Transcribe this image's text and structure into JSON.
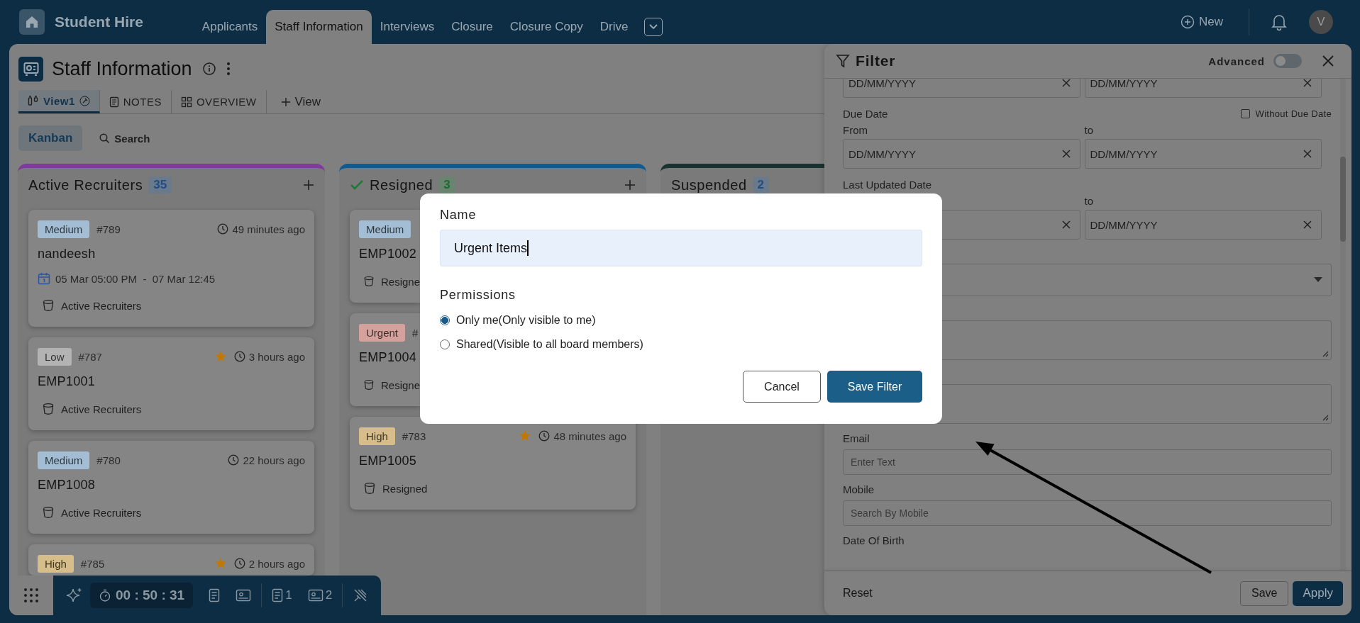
{
  "top_bar": {
    "app_name": "Student Hire",
    "tabs": [
      {
        "label": "Applicants",
        "selected": false
      },
      {
        "label": "Staff Information",
        "selected": true
      },
      {
        "label": "Interviews",
        "selected": false
      },
      {
        "label": "Closure",
        "selected": false
      },
      {
        "label": "Closure Copy",
        "selected": false
      },
      {
        "label": "Drive",
        "selected": false
      }
    ],
    "new_label": "New",
    "avatar": "V"
  },
  "page": {
    "title": "Staff Information",
    "view_tabs": [
      {
        "label": "View1",
        "selected": true,
        "kind": "view"
      },
      {
        "label": "NOTES",
        "selected": false,
        "kind": "notes"
      },
      {
        "label": "OVERVIEW",
        "selected": false,
        "kind": "overview"
      }
    ],
    "add_view": "View",
    "mode_button": "Kanban",
    "search_label": "Search"
  },
  "columns": [
    {
      "title": "Active Recruiters",
      "count": "35",
      "color": "#7f3a9a",
      "kind": "open",
      "cards": [
        {
          "priority": {
            "label": "Medium",
            "color": "#a3bdd4"
          },
          "number": "#789",
          "starred": false,
          "time": "49 minutes ago",
          "title": "nandeesh",
          "dates": "05 Mar 05:00 PM  -  07 Mar 12:45",
          "stage": "Active Recruiters"
        },
        {
          "priority": {
            "label": "Low",
            "color": "#b3b3b3"
          },
          "number": "#787",
          "starred": true,
          "time": "3 hours ago",
          "title": "EMP1001",
          "stage": "Active Recruiters"
        },
        {
          "priority": {
            "label": "Medium",
            "color": "#a3bdd4"
          },
          "number": "#780",
          "starred": false,
          "time": "22 hours ago",
          "title": "EMP1008",
          "stage": "Active Recruiters"
        },
        {
          "priority": {
            "label": "High",
            "color": "#d6bd8a"
          },
          "number": "#785",
          "starred": true,
          "time": "2 hours ago"
        }
      ]
    },
    {
      "title": "Resigned",
      "count": "3",
      "color": "#0f5a91",
      "kind": "done",
      "cards": [
        {
          "priority": {
            "label": "Medium",
            "color": "#a3bdd4"
          },
          "title": "EMP1002",
          "stage": "Resigne"
        },
        {
          "priority": {
            "label": "Urgent",
            "color": "#d4a19c"
          },
          "number": "#",
          "title": "EMP1004",
          "stage": "Resigne"
        },
        {
          "priority": {
            "label": "High",
            "color": "#d6bd8a"
          },
          "number": "#783",
          "starred": true,
          "time": "48 minutes ago",
          "title": "EMP1005",
          "stage": "Resigned"
        }
      ]
    },
    {
      "title": "Suspended",
      "count": "2",
      "color": "#1b3232",
      "kind": "open"
    }
  ],
  "filter": {
    "title": "Filter",
    "advanced": {
      "label": "Advanced",
      "on": false
    },
    "sections": [
      {
        "kind": "date_range",
        "fields": [
          {
            "kind": "date",
            "placeholder": "DD/MM/YYYY"
          },
          {
            "kind": "date",
            "placeholder": "DD/MM/YYYY"
          }
        ]
      },
      {
        "kind": "date_range",
        "label": "Due Date",
        "option": {
          "label": "Without Due Date",
          "checked": false
        },
        "from": "From",
        "to": "to",
        "fields": [
          {
            "kind": "date",
            "placeholder": "DD/MM/YYYY"
          },
          {
            "kind": "date",
            "placeholder": "DD/MM/YYYY"
          }
        ]
      },
      {
        "kind": "date_range",
        "label": "Last Updated Date",
        "to": "to",
        "fields": [
          {
            "kind": "date"
          },
          {
            "kind": "date",
            "placeholder": "DD/MM/YYYY"
          }
        ]
      },
      {
        "kind": "select"
      },
      {
        "kind": "textarea"
      },
      {
        "kind": "textarea"
      },
      {
        "kind": "text",
        "label": "Email",
        "placeholder": "Enter Text"
      },
      {
        "kind": "text",
        "label": "Mobile",
        "placeholder": "Search By Mobile"
      },
      {
        "kind": "label",
        "label": "Date Of Birth"
      }
    ],
    "reset": "Reset",
    "save": "Save",
    "apply": "Apply"
  },
  "toolbar": {
    "timer": "00 : 50 : 31",
    "note_count": "1",
    "card_count": "2"
  },
  "modal": {
    "name_label": "Name",
    "name_value": "Urgent Items",
    "permissions_label": "Permissions",
    "options": [
      {
        "label": "Only me(Only visible to me)",
        "selected": true
      },
      {
        "label": "Shared(Visible to all board members)",
        "selected": false
      }
    ],
    "cancel": "Cancel",
    "save": "Save Filter"
  }
}
